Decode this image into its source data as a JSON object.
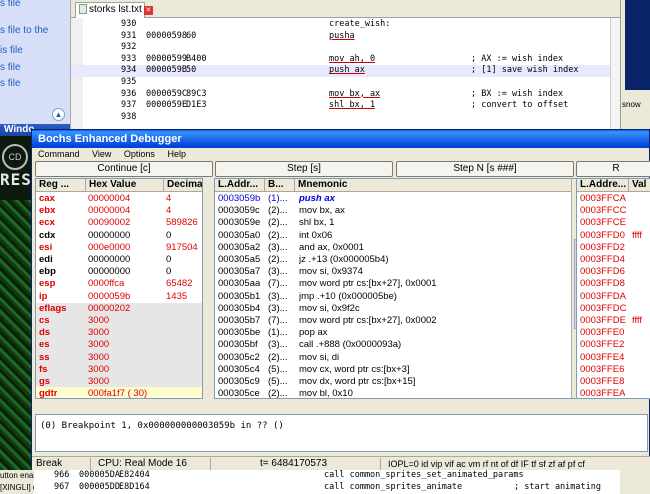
{
  "explorer": {
    "links": [
      "s file",
      "s file to the",
      "is file",
      "s file",
      "s file"
    ]
  },
  "game": {
    "text": "RESI"
  },
  "explorer_window_title": "Windo",
  "editor": {
    "tab_title": "storks lst.txt",
    "lines": [
      {
        "n": "930",
        "addr": "",
        "hex": "",
        "code": "create_wish:",
        "comment": "",
        "hl": false
      },
      {
        "n": "931",
        "addr": "00000598",
        "hex": "60",
        "code": "pusha",
        "comment": "",
        "hl": false
      },
      {
        "n": "932",
        "addr": "",
        "hex": "",
        "code": "",
        "comment": "",
        "hl": false
      },
      {
        "n": "933",
        "addr": "00000599",
        "hex": "B400",
        "code": "mov ah, 0",
        "comment": "; AX := wish index",
        "hl": false
      },
      {
        "n": "934",
        "addr": "0000059B",
        "hex": "50",
        "code": "push ax",
        "comment": "; [1] save wish index",
        "hl": true
      },
      {
        "n": "935",
        "addr": "",
        "hex": "",
        "code": "",
        "comment": "",
        "hl": false
      },
      {
        "n": "936",
        "addr": "0000059C",
        "hex": "89C3",
        "code": "mov bx, ax",
        "comment": "; BX := wish index",
        "hl": false
      },
      {
        "n": "937",
        "addr": "0000059E",
        "hex": "D1E3",
        "code": "shl bx, 1",
        "comment": "; convert to offset",
        "hl": false
      },
      {
        "n": "938",
        "addr": "",
        "hex": "",
        "code": "",
        "comment": "",
        "hl": false
      }
    ]
  },
  "right_background": {
    "label": "snow"
  },
  "debugger": {
    "title": "Bochs Enhanced Debugger",
    "menu": [
      "Command",
      "View",
      "Options",
      "Help"
    ],
    "buttons": [
      "Continue [c]",
      "Step [s]",
      "Step N [s ###]",
      "R"
    ],
    "reg_headers": [
      "Reg ...",
      "Hex Value",
      "Decima"
    ],
    "registers": [
      {
        "name": "cax",
        "hex": "00000004",
        "dec": "4",
        "color": "red"
      },
      {
        "name": "ebx",
        "hex": "00000004",
        "dec": "4",
        "color": "red"
      },
      {
        "name": "ecx",
        "hex": "00090002",
        "dec": "589826",
        "color": "red"
      },
      {
        "name": "cdx",
        "hex": "00000000",
        "dec": "0",
        "color": "black"
      },
      {
        "name": "esi",
        "hex": "000e0000",
        "dec": "917504",
        "color": "red"
      },
      {
        "name": "edi",
        "hex": "00000000",
        "dec": "0",
        "color": "black"
      },
      {
        "name": "ebp",
        "hex": "00000000",
        "dec": "0",
        "color": "black"
      },
      {
        "name": "esp",
        "hex": "0000ffca",
        "dec": "65482",
        "color": "red"
      },
      {
        "name": "ip",
        "hex": "0000059b",
        "dec": "1435",
        "color": "red"
      },
      {
        "name": "eflags",
        "hex": "00000202",
        "dec": "",
        "color": "red"
      },
      {
        "name": "cs",
        "hex": "3000",
        "dec": "",
        "color": "red"
      },
      {
        "name": "ds",
        "hex": "3000",
        "dec": "",
        "color": "red"
      },
      {
        "name": "es",
        "hex": "3000",
        "dec": "",
        "color": "red"
      },
      {
        "name": "ss",
        "hex": "3000",
        "dec": "",
        "color": "red"
      },
      {
        "name": "fs",
        "hex": "3000",
        "dec": "",
        "color": "red"
      },
      {
        "name": "gs",
        "hex": "3000",
        "dec": "",
        "color": "red"
      },
      {
        "name": "gdtr",
        "hex": "000fa1f7 ( 30)",
        "dec": "",
        "color": "red"
      }
    ],
    "asm_headers": [
      "L.Addr...",
      "B...",
      "Mnemonic"
    ],
    "asm": [
      {
        "addr": "0003059b",
        "bytes": "(1)...",
        "mnem": "push ax",
        "current": true
      },
      {
        "addr": "0003059c",
        "bytes": "(2)...",
        "mnem": "mov bx, ax",
        "current": false
      },
      {
        "addr": "0003059e",
        "bytes": "(2)...",
        "mnem": "shl bx, 1",
        "current": false
      },
      {
        "addr": "000305a0",
        "bytes": "(2)...",
        "mnem": "int 0x06",
        "current": false
      },
      {
        "addr": "000305a2",
        "bytes": "(3)...",
        "mnem": "and ax, 0x0001",
        "current": false
      },
      {
        "addr": "000305a5",
        "bytes": "(2)...",
        "mnem": "jz .+13 (0x000005b4)",
        "current": false
      },
      {
        "addr": "000305a7",
        "bytes": "(3)...",
        "mnem": "mov si, 0x9374",
        "current": false
      },
      {
        "addr": "000305aa",
        "bytes": "(7)...",
        "mnem": "mov word ptr cs:[bx+27], 0x0001",
        "current": false
      },
      {
        "addr": "000305b1",
        "bytes": "(3)...",
        "mnem": "jmp .+10 (0x000005be)",
        "current": false
      },
      {
        "addr": "000305b4",
        "bytes": "(3)...",
        "mnem": "mov si, 0x9f2c",
        "current": false
      },
      {
        "addr": "000305b7",
        "bytes": "(7)...",
        "mnem": "mov word ptr cs:[bx+27], 0x0002",
        "current": false
      },
      {
        "addr": "000305be",
        "bytes": "(1)...",
        "mnem": "pop ax",
        "current": false
      },
      {
        "addr": "000305bf",
        "bytes": "(3)...",
        "mnem": "call .+888 (0x0000093a)",
        "current": false
      },
      {
        "addr": "000305c2",
        "bytes": "(2)...",
        "mnem": "mov si, di",
        "current": false
      },
      {
        "addr": "000305c4",
        "bytes": "(5)...",
        "mnem": "mov cx, word ptr cs:[bx+3]",
        "current": false
      },
      {
        "addr": "000305c9",
        "bytes": "(5)...",
        "mnem": "mov dx, word ptr cs:[bx+15]",
        "current": false
      },
      {
        "addr": "000305ce",
        "bytes": "(2)...",
        "mnem": "mov bl, 0x10",
        "current": false
      }
    ],
    "mem_headers": [
      "L.Addre...",
      "Val"
    ],
    "memory": [
      "0003FFCA",
      "0003FFCC",
      "0003FFCE",
      "0003FFD0",
      "0003FFD2",
      "0003FFD4",
      "0003FFD6",
      "0003FFD8",
      "0003FFDA",
      "0003FFDC",
      "0003FFDE",
      "0003FFE0",
      "0003FFE2",
      "0003FFE4",
      "0003FFE6",
      "0003FFE8",
      "0003FFEA"
    ],
    "mem_values": [
      "",
      "",
      "",
      "ffff",
      "",
      "",
      "",
      "",
      "",
      "",
      "ffff",
      "",
      "",
      "",
      "",
      "",
      ""
    ],
    "output": "(0) Breakpoint 1, 0x000000000003059b in ?? ()",
    "status": {
      "state": "Break",
      "cpu": "CPU: Real Mode 16",
      "ticks": "t= 6484170573",
      "flags": "IOPL=0 id vip vif ac vm rf nt of df IF tf sf zf af pf cf"
    }
  },
  "bottom_editor": {
    "lines": [
      {
        "n": "966",
        "addr": "000005DA",
        "hex": "E82404",
        "code": "call common_sprites_set_animated_params",
        "comment": ""
      },
      {
        "n": "967",
        "addr": "000005DD",
        "hex": "E8D164",
        "code": "call common_sprites_animate",
        "comment": "; start animating"
      }
    ]
  },
  "left_status": [
    "utton enables mouse",
    "[XINGLI] dir"
  ]
}
